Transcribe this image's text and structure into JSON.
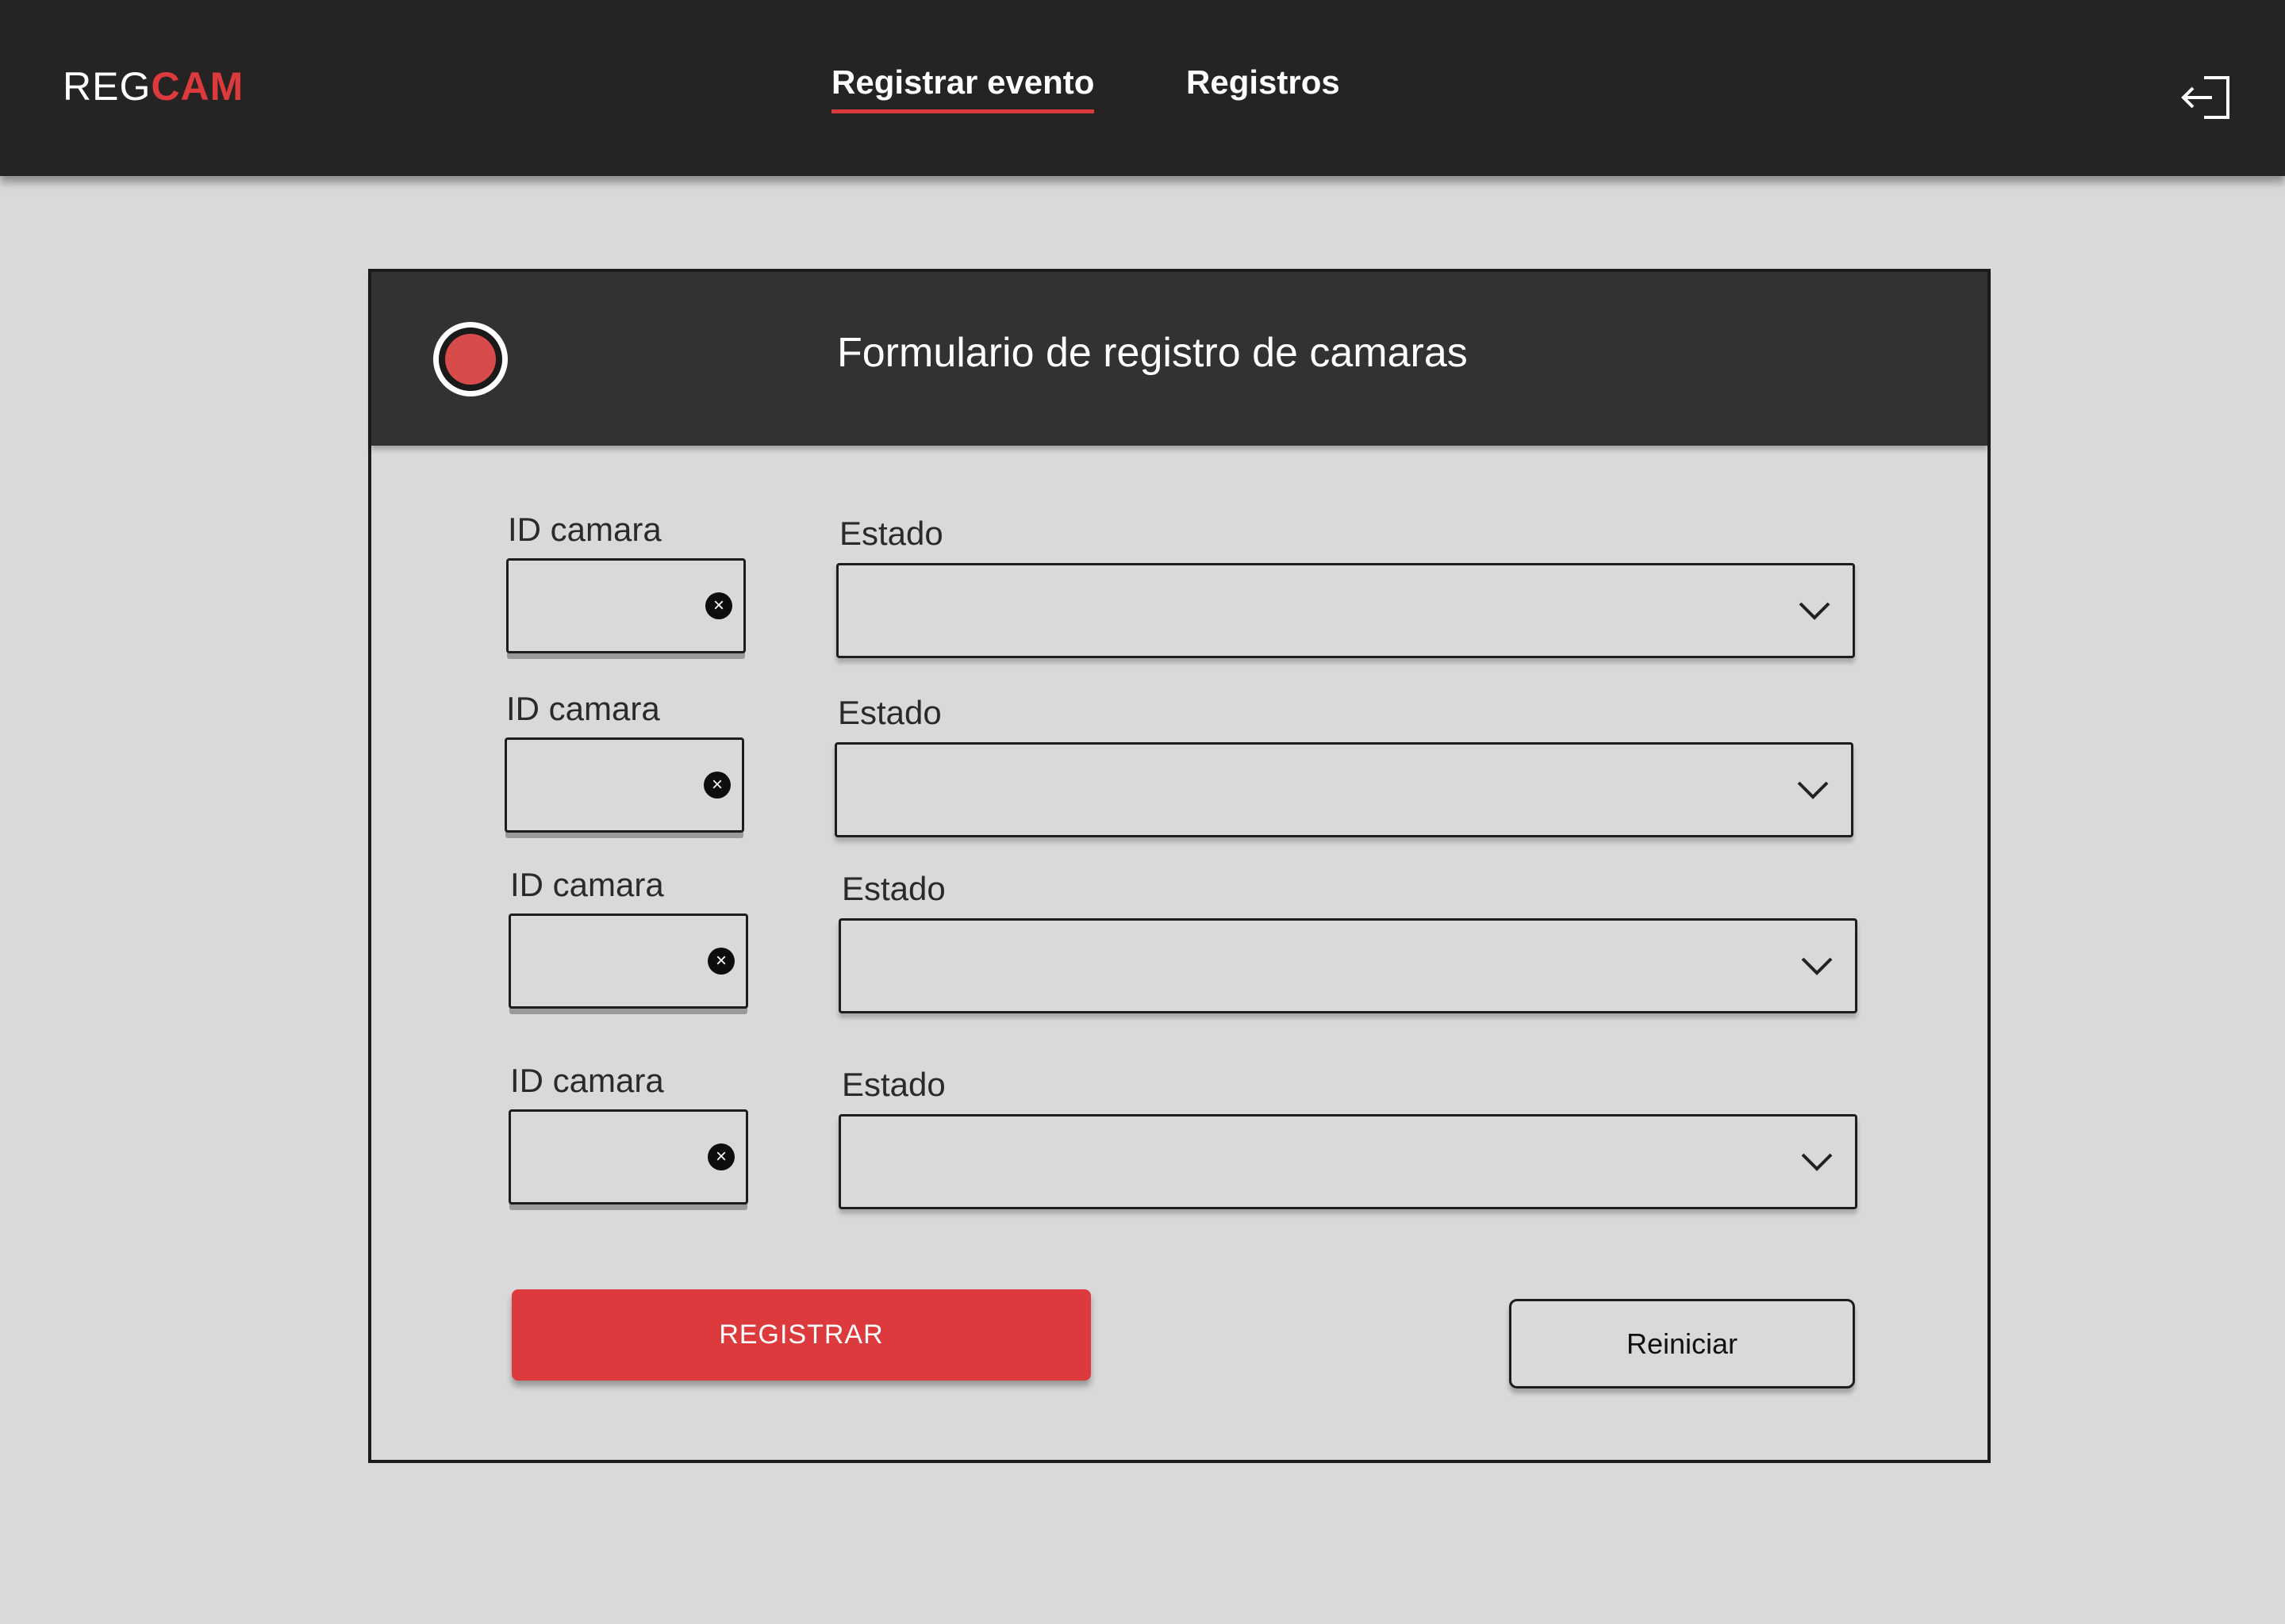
{
  "header": {
    "logo_part1": "REG",
    "logo_part2": "CAM",
    "tabs": [
      {
        "label": "Registrar evento",
        "active": true
      },
      {
        "label": "Registros",
        "active": false
      }
    ],
    "logout_icon": "logout-icon"
  },
  "form": {
    "title": "Formulario de registro de camaras",
    "indicator_icon": "record-indicator-icon",
    "rows": [
      {
        "id_label": "ID camara",
        "id_value": "",
        "state_label": "Estado",
        "state_value": ""
      },
      {
        "id_label": "ID camara",
        "id_value": "",
        "state_label": "Estado",
        "state_value": ""
      },
      {
        "id_label": "ID camara",
        "id_value": "",
        "state_label": "Estado",
        "state_value": ""
      },
      {
        "id_label": "ID camara",
        "id_value": "",
        "state_label": "Estado",
        "state_value": ""
      }
    ],
    "submit_label": "REGISTRAR",
    "reset_label": "Reiniciar"
  },
  "colors": {
    "accent": "#dc3a3c",
    "topbar": "#252423",
    "panel_header": "#333231",
    "background": "#d9d9d9"
  }
}
